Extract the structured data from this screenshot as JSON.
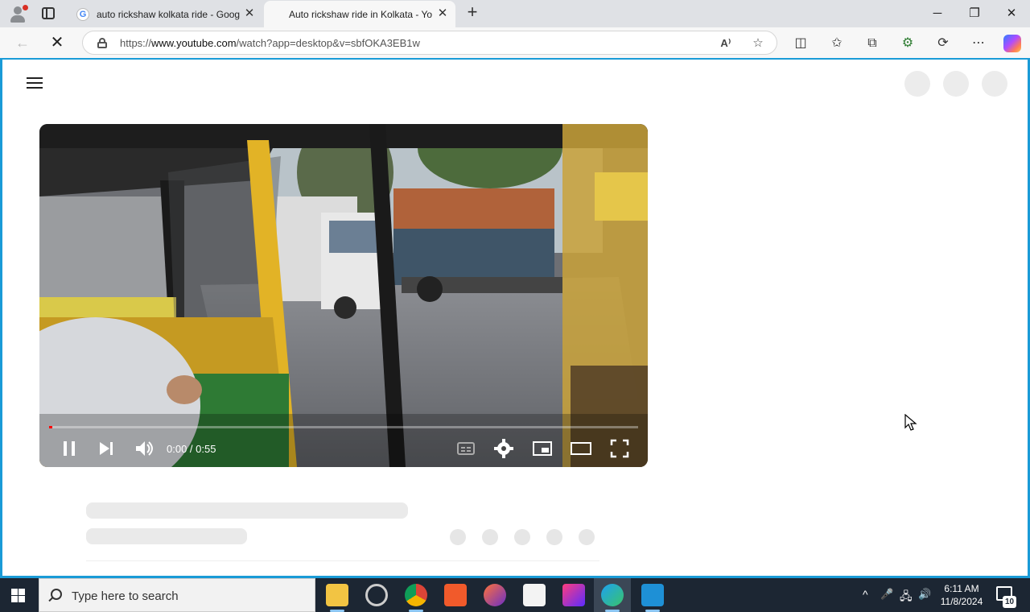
{
  "browser": {
    "tabs": [
      {
        "title": "auto rickshaw kolkata ride - Goog",
        "favicon_letter": "G",
        "close": "✕"
      },
      {
        "title": "Auto rickshaw ride in Kolkata - Yo",
        "close": "✕"
      }
    ],
    "new_tab": "+",
    "window_controls": {
      "minimize": "─",
      "restore": "❐",
      "close": "✕"
    },
    "nav": {
      "back": "←",
      "stop": "✕"
    },
    "url_prefix": "https://",
    "url_domain": "www.youtube.com",
    "url_path": "/watch?app=desktop&v=sbfOKA3EB1w",
    "omnibox_icons": {
      "read_aloud": "A⁾",
      "favorite": "☆"
    },
    "toolbar_icons": {
      "split": "◫",
      "favorites": "✩",
      "collections": "⧉",
      "extensions": "⚙",
      "sync": "⟳",
      "more": "⋯"
    }
  },
  "video": {
    "time": "0:00 / 0:55",
    "progress_fraction": 0.0,
    "controls": [
      "pause-icon",
      "next-icon",
      "volume-icon",
      "captions-icon",
      "settings-icon",
      "miniplayer-icon",
      "theater-icon",
      "fullscreen-icon"
    ]
  },
  "taskbar": {
    "search_placeholder": "Type here to search",
    "clock_time": "6:11 AM",
    "clock_date": "11/8/2024",
    "notification_count": "10",
    "tray": {
      "chevron": "^",
      "mic": "🎤",
      "network": "🖧",
      "volume": "🔊"
    }
  },
  "colors": {
    "accent": "#1a9bd7",
    "progress": "#ff0000",
    "taskbar": "#1c2633"
  }
}
